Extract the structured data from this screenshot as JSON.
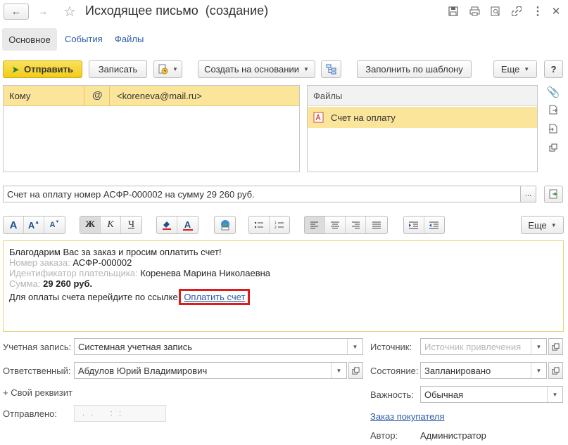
{
  "window": {
    "title": "Исходящее письмо  (создание)"
  },
  "tabs": [
    {
      "label": "Основное"
    },
    {
      "label": "События"
    },
    {
      "label": "Файлы"
    }
  ],
  "toolbar": {
    "send_label": "Отправить",
    "save_label": "Записать",
    "create_based_label": "Создать на основании",
    "fill_template_label": "Заполнить по шаблону",
    "more_label": "Еще",
    "help_label": "?"
  },
  "recipients": {
    "row_label": "Кому",
    "at_symbol": "@",
    "email": "<koreneva@mail.ru>"
  },
  "files": {
    "header": "Файлы",
    "items": [
      {
        "name": "Счет на оплату"
      }
    ]
  },
  "subject": {
    "value": "Счет на оплату номер АСФР-000002 на сумму 29 260 руб.",
    "select_label": "..."
  },
  "format_toolbar": {
    "font_large": "A",
    "font_bigger": "A",
    "font_smaller": "A",
    "bold": "Ж",
    "italic": "К",
    "underline": "Ч",
    "font_color": "A",
    "more_label": "Еще"
  },
  "body": {
    "line1": "Благодарим Вас за заказ и просим оплатить счет!",
    "order_label": "Номер заказа:",
    "order_value": "АСФР-000002",
    "payer_label": "Идентификатор плательщика:",
    "payer_value": "Коренева Марина Николаевна",
    "sum_label": "Сумма:",
    "sum_value": "29 260 руб.",
    "pay_text": "Для оплаты счета перейдите по ссылке",
    "pay_link": "Оплатить счет",
    "highlight_color": "#e01b1b"
  },
  "form": {
    "account_label": "Учетная запись:",
    "account_value": "Системная учетная запись",
    "responsible_label": "Ответственный:",
    "responsible_value": "Абдулов Юрий Владимирович",
    "custom_attr_label": "+ Свой реквизит",
    "sent_label": "Отправлено:",
    "sent_value": ".   .        :   :",
    "source_label": "Источник:",
    "source_placeholder": "Источник привлечения",
    "state_label": "Состояние:",
    "state_value": "Запланировано",
    "importance_label": "Важность:",
    "importance_value": "Обычная",
    "order_link": "Заказ покупателя",
    "author_label": "Автор:",
    "author_value": "Администратор"
  },
  "colors": {
    "accent_yellow": "#f5d22b",
    "selected_row": "#fbe59a",
    "link": "#2a5ba8",
    "field_border": "#bdbdbd"
  }
}
